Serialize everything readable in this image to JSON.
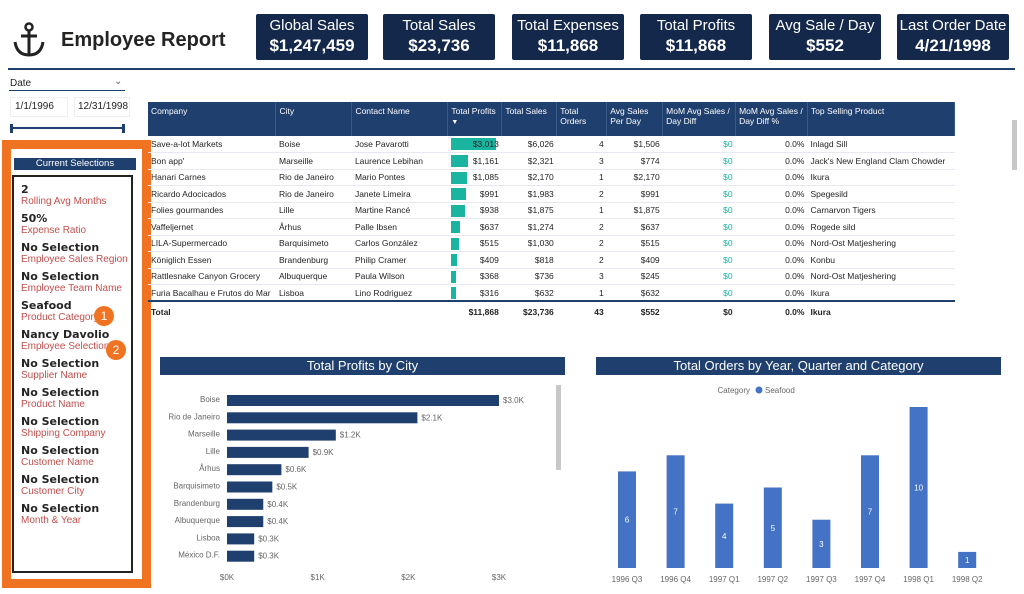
{
  "header": {
    "title": "Employee Report",
    "logo_icon": "anchor-icon"
  },
  "kpis": [
    {
      "label": "Global Sales",
      "value": "$1,247,459"
    },
    {
      "label": "Total Sales",
      "value": "$23,736"
    },
    {
      "label": "Total Expenses",
      "value": "$11,868"
    },
    {
      "label": "Total Profits",
      "value": "$11,868"
    },
    {
      "label": "Avg Sale / Day",
      "value": "$552"
    },
    {
      "label": "Last Order Date",
      "value": "4/21/1998"
    }
  ],
  "date_slicer": {
    "label": "Date",
    "start": "1/1/1996",
    "end": "12/31/1998",
    "range_fraction": [
      0,
      1
    ]
  },
  "selections": {
    "title": "Current Selections",
    "items": [
      {
        "value": "2",
        "label": "Rolling Avg Months"
      },
      {
        "value": "50%",
        "label": "Expense Ratio"
      },
      {
        "value": "No Selection",
        "label": "Employee Sales Region"
      },
      {
        "value": "No Selection",
        "label": "Employee Team Name"
      },
      {
        "value": "Seafood",
        "label": "Product Category"
      },
      {
        "value": "Nancy Davolio",
        "label": "Employee Selection"
      },
      {
        "value": "No Selection",
        "label": "Supplier Name"
      },
      {
        "value": "No Selection",
        "label": "Product Name"
      },
      {
        "value": "No Selection",
        "label": "Shipping Company"
      },
      {
        "value": "No Selection",
        "label": "Customer Name"
      },
      {
        "value": "No Selection",
        "label": "Customer City"
      },
      {
        "value": "No Selection",
        "label": "Month & Year"
      }
    ]
  },
  "badges": [
    "1",
    "2"
  ],
  "table": {
    "columns": [
      "Company",
      "City",
      "Contact Name",
      "Total Profits",
      "Total Sales",
      "Total Orders",
      "Avg Sales Per Day",
      "MoM Avg Sales / Day Diff",
      "MoM Avg Sales / Day Diff %",
      "Top Selling Product"
    ],
    "rows": [
      [
        "Save-a-lot Markets",
        "Boise",
        "Jose Pavarotti",
        "$3,013",
        "$6,026",
        "4",
        "$1,506",
        "$0",
        "0.0%",
        "Inlagd Sill"
      ],
      [
        "Bon app'",
        "Marseille",
        "Laurence Lebihan",
        "$1,161",
        "$2,321",
        "3",
        "$774",
        "$0",
        "0.0%",
        "Jack's New England Clam Chowder"
      ],
      [
        "Hanari Carnes",
        "Rio de Janeiro",
        "Mario Pontes",
        "$1,085",
        "$2,170",
        "1",
        "$2,170",
        "$0",
        "0.0%",
        "Ikura"
      ],
      [
        "Ricardo Adocicados",
        "Rio de Janeiro",
        "Janete Limeira",
        "$991",
        "$1,983",
        "2",
        "$991",
        "$0",
        "0.0%",
        "Spegesild"
      ],
      [
        "Folies gourmandes",
        "Lille",
        "Martine Rancé",
        "$938",
        "$1,875",
        "1",
        "$1,875",
        "$0",
        "0.0%",
        "Carnarvon Tigers"
      ],
      [
        "Vaffeljernet",
        "Århus",
        "Palle Ibsen",
        "$637",
        "$1,274",
        "2",
        "$637",
        "$0",
        "0.0%",
        "Rogede sild"
      ],
      [
        "LILA-Supermercado",
        "Barquisimeto",
        "Carlos González",
        "$515",
        "$1,030",
        "2",
        "$515",
        "$0",
        "0.0%",
        "Nord-Ost Matjeshering"
      ],
      [
        "Königlich Essen",
        "Brandenburg",
        "Philip Cramer",
        "$409",
        "$818",
        "2",
        "$409",
        "$0",
        "0.0%",
        "Konbu"
      ],
      [
        "Rattlesnake Canyon Grocery",
        "Albuquerque",
        "Paula Wilson",
        "$368",
        "$736",
        "3",
        "$245",
        "$0",
        "0.0%",
        "Nord-Ost Matjeshering"
      ],
      [
        "Furia Bacalhau e Frutos do Mar",
        "Lisboa",
        "Lino Rodriguez",
        "$316",
        "$632",
        "1",
        "$632",
        "$0",
        "0.0%",
        "Ikura"
      ]
    ],
    "total": [
      "Total",
      "",
      "",
      "$11,868",
      "$23,736",
      "43",
      "$552",
      "$0",
      "0.0%",
      "Ikura"
    ],
    "profit_bar_color": "#1ab5a0"
  },
  "chart_data": [
    {
      "type": "bar",
      "orientation": "horizontal",
      "title": "Total Profits by City",
      "categories": [
        "Boise",
        "Rio de Janeiro",
        "Marseille",
        "Lille",
        "Århus",
        "Barquisimeto",
        "Brandenburg",
        "Albuquerque",
        "Lisboa",
        "México D.F."
      ],
      "values": [
        3.0,
        2.1,
        1.2,
        0.9,
        0.6,
        0.5,
        0.4,
        0.4,
        0.3,
        0.3
      ],
      "data_labels": [
        "$3.0K",
        "$2.1K",
        "$1.2K",
        "$0.9K",
        "$0.6K",
        "$0.5K",
        "$0.4K",
        "$0.4K",
        "$0.3K",
        "$0.3K"
      ],
      "xticks": [
        "$0K",
        "$1K",
        "$2K",
        "$3K"
      ],
      "xlim": [
        0,
        3
      ],
      "color": "#1f3f6e"
    },
    {
      "type": "bar",
      "title": "Total Orders by Year, Quarter and Category",
      "legend_title": "Category",
      "series": [
        {
          "name": "Seafood",
          "values": [
            6,
            7,
            4,
            5,
            3,
            7,
            10,
            1
          ]
        }
      ],
      "categories": [
        "1996 Q3",
        "1996 Q4",
        "1997 Q1",
        "1997 Q2",
        "1997 Q3",
        "1997 Q4",
        "1998 Q1",
        "1998 Q2"
      ],
      "ylim": [
        0,
        10
      ],
      "color": "#4472c4",
      "legend_position": "top"
    }
  ]
}
